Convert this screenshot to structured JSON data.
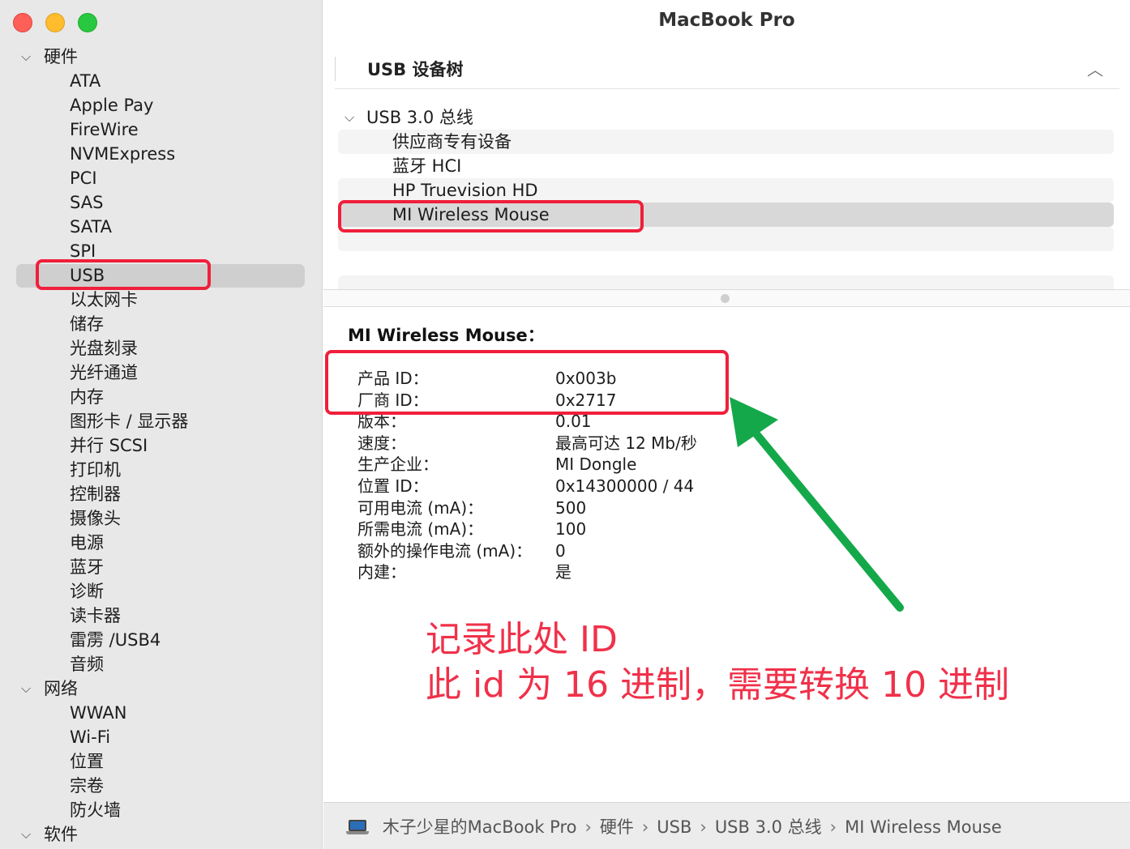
{
  "window": {
    "title": "MacBook Pro"
  },
  "sidebar": {
    "groups": [
      {
        "label": "硬件",
        "items": [
          "ATA",
          "Apple Pay",
          "FireWire",
          "NVMExpress",
          "PCI",
          "SAS",
          "SATA",
          "SPI",
          "USB",
          "以太网卡",
          "储存",
          "光盘刻录",
          "光纤通道",
          "内存",
          "图形卡 / 显示器",
          "并行 SCSI",
          "打印机",
          "控制器",
          "摄像头",
          "电源",
          "蓝牙",
          "诊断",
          "读卡器",
          "雷雳 /USB4",
          "音频"
        ]
      },
      {
        "label": "网络",
        "items": [
          "WWAN",
          "Wi-Fi",
          "位置",
          "宗卷",
          "防火墙"
        ]
      },
      {
        "label": "软件",
        "items": []
      }
    ],
    "selected": "USB"
  },
  "section": {
    "title": "USB 设备树"
  },
  "tree": {
    "root": "USB 3.0 总线",
    "children": [
      "供应商专有设备",
      "蓝牙 HCI",
      "HP Truevision HD",
      "MI Wireless Mouse"
    ],
    "selected": "MI Wireless Mouse"
  },
  "detail": {
    "title": "MI Wireless Mouse：",
    "properties": [
      {
        "key": "产品 ID：",
        "value": "0x003b"
      },
      {
        "key": "厂商 ID：",
        "value": "0x2717"
      },
      {
        "key": "版本：",
        "value": "0.01"
      },
      {
        "key": "速度：",
        "value": "最高可达 12 Mb/秒"
      },
      {
        "key": "生产企业：",
        "value": "MI Dongle"
      },
      {
        "key": "位置 ID：",
        "value": "0x14300000 / 44"
      },
      {
        "key": "可用电流 (mA)：",
        "value": "500"
      },
      {
        "key": "所需电流 (mA)：",
        "value": "100"
      },
      {
        "key": "额外的操作电流 (mA)：",
        "value": "0"
      },
      {
        "key": "内建：",
        "value": "是"
      }
    ]
  },
  "annotation": {
    "line1": "记录此处 ID",
    "line2": "此 id 为 16 进制，需要转换 10 进制",
    "color": "#f0314a"
  },
  "pathbar": {
    "icon": "laptop-icon",
    "crumbs": [
      "木子少星的MacBook Pro",
      "硬件",
      "USB",
      "USB 3.0 总线",
      "MI Wireless Mouse"
    ],
    "separator": "›"
  },
  "colors": {
    "highlight_box": "#f01f3b",
    "arrow": "#14a84a"
  }
}
